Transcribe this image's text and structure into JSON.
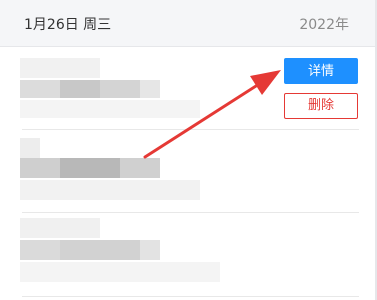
{
  "header": {
    "date": "1月26日 周三",
    "year": "2022年"
  },
  "actions": {
    "detail_label": "详情",
    "delete_label": "删除"
  },
  "colors": {
    "primary": "#1e90ff",
    "danger": "#e53935",
    "annotation_arrow": "#e53935"
  }
}
